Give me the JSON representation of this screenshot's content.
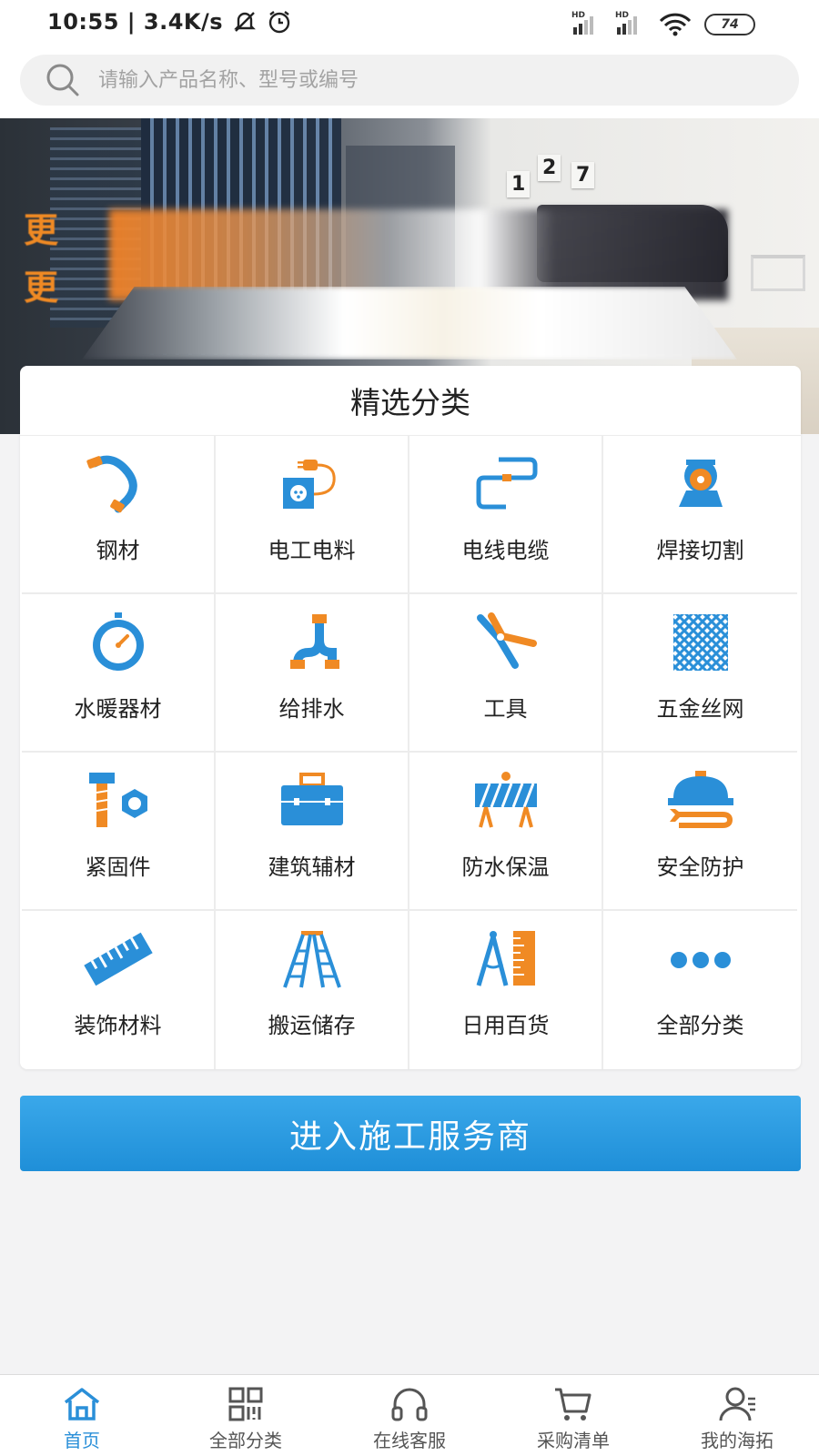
{
  "status_bar": {
    "time": "10:55",
    "net_speed": "3.4K/s",
    "signal_tag": "HD",
    "battery": "74"
  },
  "search": {
    "placeholder": "请输入产品名称、型号或编号"
  },
  "banner": {
    "numbers": [
      "1",
      "2",
      "7"
    ],
    "text_lines": [
      "更",
      "更"
    ]
  },
  "categories": {
    "title": "精选分类",
    "items": [
      {
        "label": "钢材",
        "icon": "bent-pipe-icon"
      },
      {
        "label": "电工电料",
        "icon": "socket-plug-icon"
      },
      {
        "label": "电线电缆",
        "icon": "cable-icon"
      },
      {
        "label": "焊接切割",
        "icon": "cutting-saw-icon"
      },
      {
        "label": "水暖器材",
        "icon": "pressure-gauge-icon"
      },
      {
        "label": "给排水",
        "icon": "drain-pipe-icon"
      },
      {
        "label": "工具",
        "icon": "pliers-icon"
      },
      {
        "label": "五金丝网",
        "icon": "wire-mesh-icon"
      },
      {
        "label": "紧固件",
        "icon": "bolt-nut-icon"
      },
      {
        "label": "建筑辅材",
        "icon": "toolbox-icon"
      },
      {
        "label": "防水保温",
        "icon": "road-barrier-icon"
      },
      {
        "label": "安全防护",
        "icon": "hardhat-wrench-icon"
      },
      {
        "label": "装饰材料",
        "icon": "ruler-icon"
      },
      {
        "label": "搬运储存",
        "icon": "ladder-icon"
      },
      {
        "label": "日用百货",
        "icon": "compass-ruler-icon"
      },
      {
        "label": "全部分类",
        "icon": "more-dots-icon"
      }
    ]
  },
  "enter_button": {
    "label": "进入施工服务商"
  },
  "tab_bar": {
    "tabs": [
      {
        "label": "首页",
        "icon": "home-icon",
        "active": true
      },
      {
        "label": "全部分类",
        "icon": "qr-grid-icon",
        "active": false
      },
      {
        "label": "在线客服",
        "icon": "headset-icon",
        "active": false
      },
      {
        "label": "采购清单",
        "icon": "cart-icon",
        "active": false
      },
      {
        "label": "我的海拓",
        "icon": "user-icon",
        "active": false
      }
    ]
  },
  "colors": {
    "accent_blue": "#2a8fd8",
    "accent_orange": "#f08a24"
  }
}
